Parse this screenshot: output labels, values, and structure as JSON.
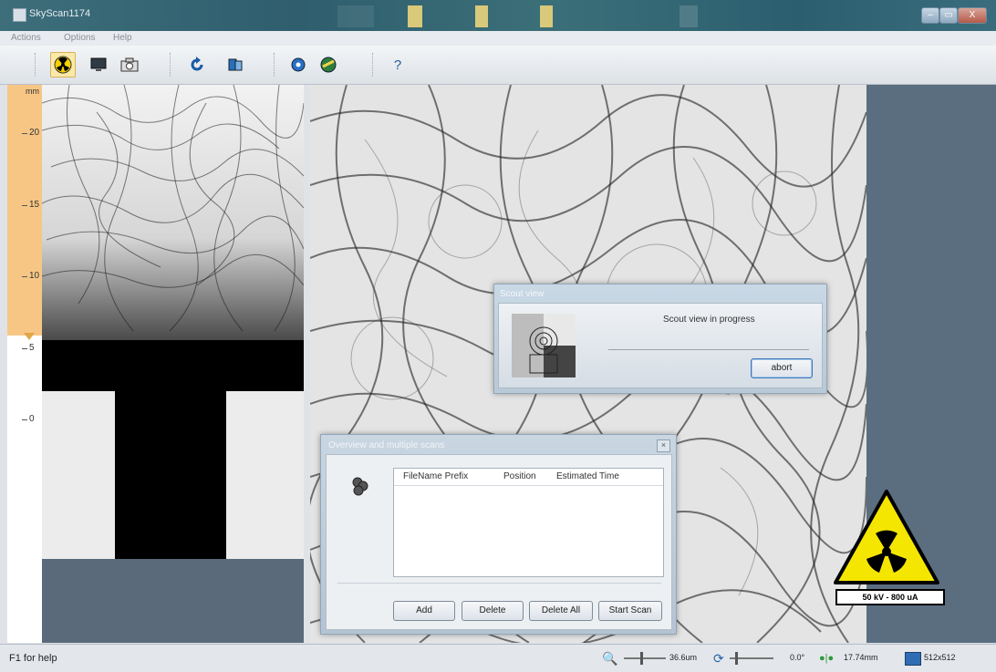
{
  "window": {
    "title": "SkyScan1174",
    "controls": [
      "–",
      "▭",
      "X"
    ]
  },
  "menu": [
    "Actions",
    "Options",
    "Help"
  ],
  "toolbar": {
    "icons": [
      "xray-source-icon",
      "monitor-icon",
      "camera-icon",
      "rotate-icon",
      "scan-icon",
      "settings-icon",
      "reconstruct-icon",
      "help-icon"
    ],
    "help_label": "?"
  },
  "ruler": {
    "unit": "mm",
    "labels": [
      "20",
      "15",
      "10",
      "5",
      "0"
    ]
  },
  "scout_dialog": {
    "title": "Scout view",
    "message": "Scout view in progress",
    "abort_label": "abort"
  },
  "overview_dialog": {
    "title": "Overview and multiple scans",
    "close_label": "×",
    "columns": [
      "FileName Prefix",
      "Position",
      "Estimated Time"
    ],
    "buttons": {
      "add": "Add",
      "delete": "Delete",
      "delete_all": "Delete All",
      "start_scan": "Start Scan"
    }
  },
  "warning": {
    "label": "50 kV - 800 uA"
  },
  "status": {
    "help": "F1 for help",
    "pixel_size": "36.6um",
    "angle": "0.0°",
    "position": "17.74mm",
    "resolution": "512x512"
  },
  "colors": {
    "titlebar": "#2f5e6e",
    "ruler_orange": "#f7c685",
    "background_panel": "#5b6e80",
    "warning_yellow": "#f4e600"
  }
}
